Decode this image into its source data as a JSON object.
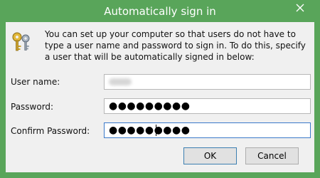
{
  "window": {
    "title": "Automatically sign in",
    "accent_color": "#59a55a"
  },
  "icons": {
    "close": "close-icon",
    "keys": "keys-icon"
  },
  "message": "You can set up your computer so that users do not have to type a user name and password to sign in. To do this, specify a user that will be automatically signed in below:",
  "fields": {
    "username": {
      "label": "User name:",
      "value": ""
    },
    "password": {
      "label": "Password:",
      "masked_value": "●●●●●●●●●"
    },
    "confirm_password": {
      "label": "Confirm Password:",
      "masked_value": "●●●●●●●●●"
    }
  },
  "buttons": {
    "ok": "OK",
    "cancel": "Cancel"
  }
}
